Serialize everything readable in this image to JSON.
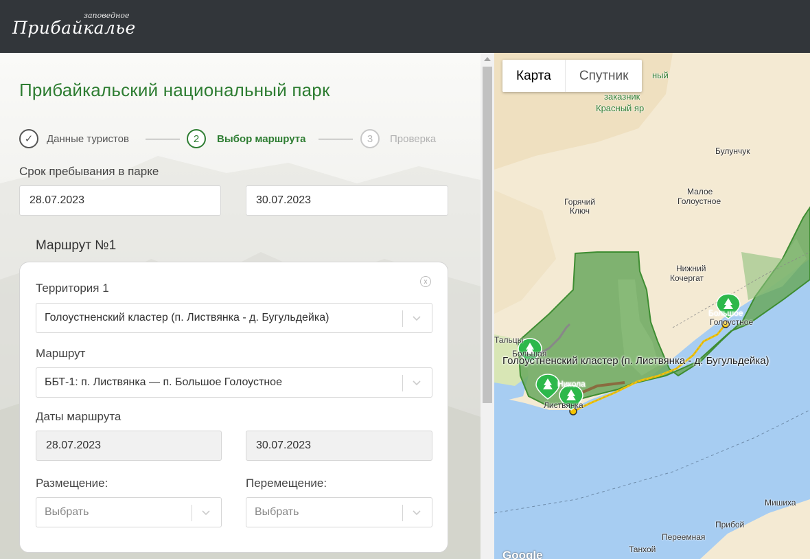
{
  "header": {
    "logo_small": "заповедное",
    "logo_big": "Прибайкалье"
  },
  "page": {
    "title": "Прибайкальский национальный парк"
  },
  "steps": [
    {
      "number": "✓",
      "label": "Данные туристов",
      "state": "done"
    },
    {
      "number": "2",
      "label": "Выбор маршрута",
      "state": "active"
    },
    {
      "number": "3",
      "label": "Проверка",
      "state": "future"
    }
  ],
  "stay": {
    "label": "Срок пребывания в парке",
    "date_from": "28.07.2023",
    "date_to": "30.07.2023"
  },
  "route": {
    "heading": "Маршрут №1",
    "close": "x",
    "territory_label": "Территория 1",
    "territory_value": "Голоустненский кластер (п. Листвянка - д. Бугульдейка)",
    "route_label": "Маршрут",
    "route_value": "ББТ-1: п. Листвянка — п. Большое Голоустное",
    "dates_label": "Даты маршрута",
    "date_from": "28.07.2023",
    "date_to": "30.07.2023",
    "accommodation_label": "Размещение:",
    "accommodation_value": "Выбрать",
    "transport_label": "Перемещение:",
    "transport_value": "Выбрать"
  },
  "map": {
    "toggle_map": "Карта",
    "toggle_satellite": "Спутник",
    "labels": {
      "reserve1": "ный",
      "reserve2": "заказник",
      "reserve3": "Красный яр",
      "bulunchuk": "Булунчук",
      "goryachy1": "Горячий",
      "goryachy2": "Ключ",
      "maloe1": "Малое",
      "maloe2": "Голоустное",
      "nizhny1": "Нижний",
      "nizhny2": "Кочергат",
      "bolshoe1": "Большое",
      "bolshoe2": "Голоустное",
      "taltsy": "Тальцы",
      "bolshaya": "Большая",
      "cluster": "Голоустненский кластер (п. Листвянка - д. Бугульдейка)",
      "nikola": "Никола",
      "listvyanka": "Листвянка",
      "mishiha": "Мишиха",
      "pribojny": "Прибой",
      "peremnaya": "Переемная",
      "tanhoy": "Танхой"
    },
    "attribution": "Google",
    "colors": {
      "land": "#f4ead3",
      "water": "#a7cdf2",
      "park": "#6aa85e",
      "route": "#f5c400",
      "marker": "#2db84b"
    }
  }
}
